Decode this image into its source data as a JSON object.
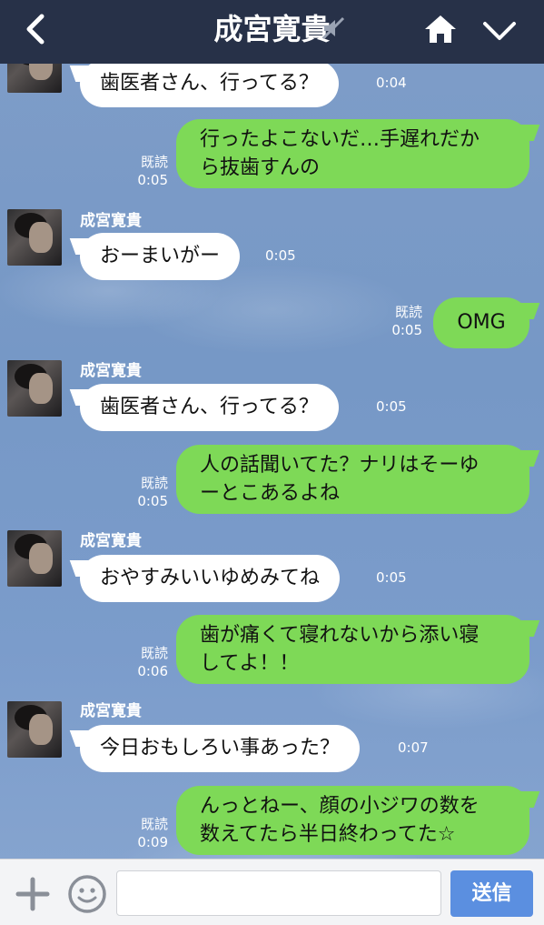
{
  "header": {
    "title": "成宮寛貴",
    "back_icon": "chevron-left-icon",
    "mute_icon": "speaker-muted-icon",
    "home_icon": "home-icon",
    "menu_icon": "chevron-down-icon"
  },
  "messages": [
    {
      "dir": "in",
      "sender": "",
      "text": "歯医者さん、行ってる？",
      "time": "0:04"
    },
    {
      "dir": "out",
      "read": "既読",
      "lines": [
        "行ったよこないだ…手遅れだか",
        "ら抜歯すんの"
      ],
      "time": "0:05"
    },
    {
      "dir": "in",
      "sender": "成宮寛貴",
      "text": "おーまいがー",
      "time": "0:05"
    },
    {
      "dir": "out",
      "read": "既読",
      "lines": [
        "OMG"
      ],
      "time": "0:05"
    },
    {
      "dir": "in",
      "sender": "成宮寛貴",
      "text": "歯医者さん、行ってる？",
      "time": "0:05"
    },
    {
      "dir": "out",
      "read": "既読",
      "lines": [
        "人の話聞いてた？ナリはそーゆ",
        "ーとこあるよね"
      ],
      "time": "0:05"
    },
    {
      "dir": "in",
      "sender": "成宮寛貴",
      "text": "おやすみいいゆめみてね",
      "time": "0:05"
    },
    {
      "dir": "out",
      "read": "既読",
      "lines": [
        "歯が痛くて寝れないから添い寝",
        "してよ！！"
      ],
      "time": "0:06"
    },
    {
      "dir": "in",
      "sender": "成宮寛貴",
      "text": "今日おもしろい事あった？",
      "time": "0:07"
    },
    {
      "dir": "out",
      "read": "既読",
      "lines": [
        "んっとねー、顔の小ジワの数を",
        "数えてたら半日終わってた☆"
      ],
      "time": "0:09"
    }
  ],
  "input_bar": {
    "plus_icon": "plus-icon",
    "emoji_icon": "emoji-smile-icon",
    "input_value": "",
    "send_label": "送信"
  },
  "colors": {
    "header_bg": "#273148",
    "chat_bg": "#7e9bc6",
    "outgoing_bubble": "#7ed957",
    "incoming_bubble": "#ffffff",
    "send_button": "#5b8fe0"
  }
}
